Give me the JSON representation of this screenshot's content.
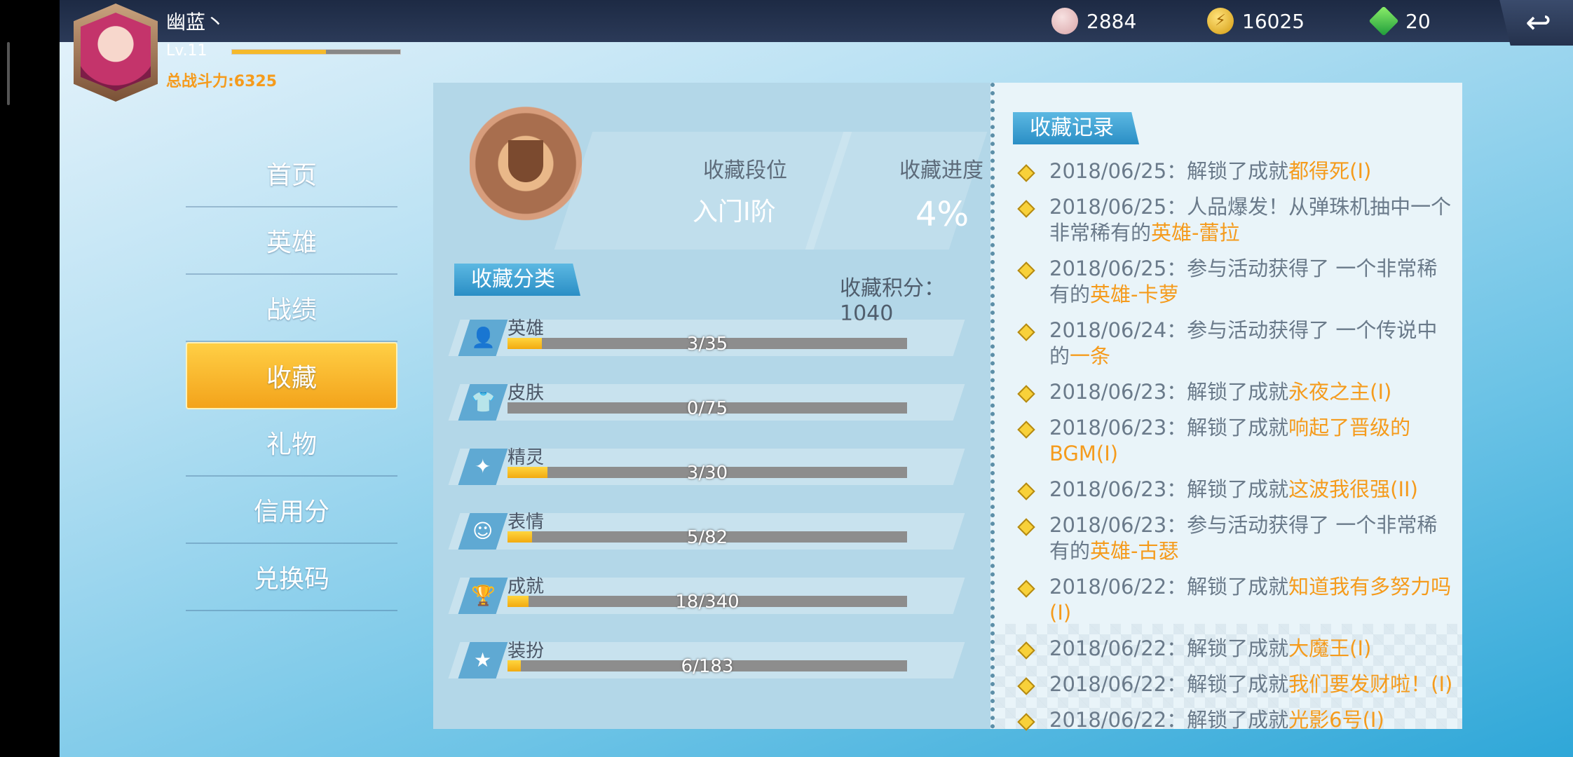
{
  "player": {
    "name": "幽蓝丶",
    "level": "Lv.11",
    "exp_fraction": 0.56,
    "power": "总战斗力:6325"
  },
  "currency": {
    "shell": "2884",
    "gold": "16025",
    "gem": "20"
  },
  "back_icon": "back-arrow-icon",
  "nav": {
    "items": [
      {
        "label": "首页"
      },
      {
        "label": "英雄"
      },
      {
        "label": "战绩"
      },
      {
        "label": "收藏"
      },
      {
        "label": "礼物"
      },
      {
        "label": "信用分"
      },
      {
        "label": "兑换码"
      }
    ],
    "active": "收藏"
  },
  "collection": {
    "rank_label": "收藏段位",
    "rank_value": "入门Ⅰ阶",
    "progress_label": "收藏进度",
    "progress_value": "4%",
    "category_title": "收藏分类",
    "score": "收藏积分：1040",
    "categories": [
      {
        "name": "英雄",
        "count": "3/35",
        "fraction": 0.086
      },
      {
        "name": "皮肤",
        "count": "0/75",
        "fraction": 0.0
      },
      {
        "name": "精灵",
        "count": "3/30",
        "fraction": 0.1
      },
      {
        "name": "表情",
        "count": "5/82",
        "fraction": 0.061
      },
      {
        "name": "成就",
        "count": "18/340",
        "fraction": 0.053
      },
      {
        "name": "装扮",
        "count": "6/183",
        "fraction": 0.033
      }
    ]
  },
  "records": {
    "title": "收藏记录",
    "items": [
      {
        "text": "2018/06/25：解锁了成就",
        "highlight": "都得死(I)"
      },
      {
        "text": "2018/06/25：人品爆发！从弹珠机抽中一个非常稀有的",
        "highlight": "英雄-蕾拉"
      },
      {
        "text": "2018/06/25：参与活动获得了 一个非常稀有的",
        "highlight": "英雄-卡萝"
      },
      {
        "text": "2018/06/24：参与活动获得了 一个传说中的",
        "highlight": "一条"
      },
      {
        "text": "2018/06/23：解锁了成就",
        "highlight": "永夜之主(I)"
      },
      {
        "text": "2018/06/23：解锁了成就",
        "highlight": "响起了晋级的BGM(I)"
      },
      {
        "text": "2018/06/23：解锁了成就",
        "highlight": "这波我很强(II)"
      },
      {
        "text": "2018/06/23：参与活动获得了 一个非常稀有的",
        "highlight": "英雄-古瑟"
      },
      {
        "text": "2018/06/22：解锁了成就",
        "highlight": "知道我有多努力吗(I)"
      },
      {
        "text": "2018/06/22：解锁了成就",
        "highlight": "大魔王(I)"
      },
      {
        "text": "2018/06/22：解锁了成就",
        "highlight": "我们要发财啦！(I)"
      },
      {
        "text": "2018/06/22：解锁了成就",
        "highlight": "光影6号(I)"
      }
    ]
  }
}
